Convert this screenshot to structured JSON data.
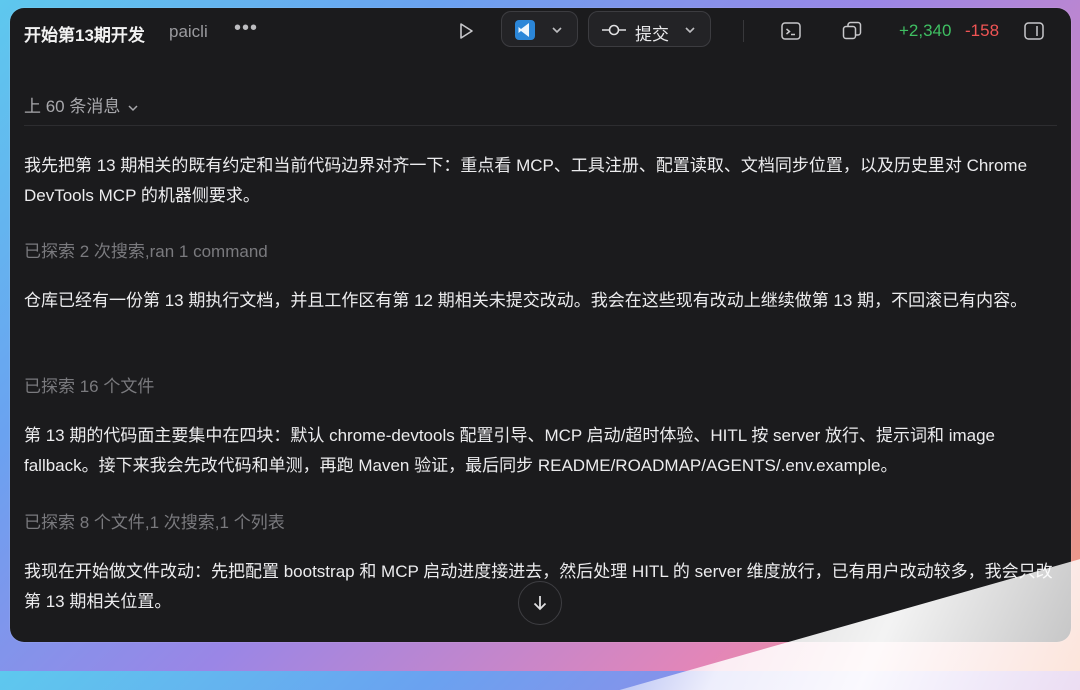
{
  "header": {
    "title": "开始第13期开发",
    "repo": "paicli",
    "more": "•••",
    "commit_label": "提交",
    "diff_added": "+2,340",
    "diff_removed": "-158"
  },
  "history": {
    "collapsed_label": "上 60 条消息"
  },
  "messages": [
    {
      "text": "我先把第 13 期相关的既有约定和当前代码边界对齐一下：重点看 MCP、工具注册、配置读取、文档同步位置，以及历史里对 Chrome DevTools MCP 的机器侧要求。"
    },
    {
      "meta": "已探索 2 次搜索,ran 1 command"
    },
    {
      "text": "仓库已经有一份第 13 期执行文档，并且工作区有第 12 期相关未提交改动。我会在这些现有改动上继续做第 13 期，不回滚已有内容。"
    },
    {
      "meta": "已探索 16 个文件"
    },
    {
      "text": "第 13 期的代码面主要集中在四块：默认 chrome-devtools 配置引导、MCP 启动/超时体验、HITL 按 server 放行、提示词和 image fallback。接下来我会先改代码和单测，再跑 Maven 验证，最后同步 README/ROADMAP/AGENTS/.env.example。"
    },
    {
      "meta": "已探索 8 个文件,1 次搜索,1 个列表"
    },
    {
      "text": "我现在开始做文件改动：先把配置 bootstrap 和 MCP 启动进度接进去，然后处理 HITL 的 server 维度放行，已有用户改动较多，我会只改第 13 期相关位置。"
    }
  ],
  "colors": {
    "added": "#3fbf62",
    "removed": "#f05454",
    "vscode": "#2b86d8"
  }
}
